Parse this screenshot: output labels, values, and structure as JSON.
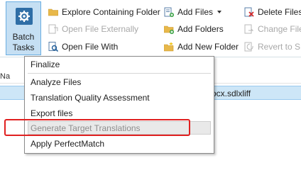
{
  "ribbon": {
    "batch_tasks": {
      "line1": "Batch",
      "line2": "Tasks"
    },
    "col1": [
      {
        "label": "Explore Containing Folder",
        "icon": "folder-icon",
        "disabled": false
      },
      {
        "label": "Open File Externally",
        "icon": "external-file-icon",
        "disabled": true
      },
      {
        "label": "Open File With",
        "icon": "search-file-icon",
        "disabled": false
      }
    ],
    "col2": [
      {
        "label": "Add Files",
        "icon": "add-files-icon",
        "disabled": false
      },
      {
        "label": "Add Folders",
        "icon": "add-folder-icon",
        "disabled": false
      },
      {
        "label": "Add New Folder",
        "icon": "new-folder-icon",
        "disabled": false
      }
    ],
    "col3": [
      {
        "label": "Delete Files",
        "icon": "delete-files-icon",
        "disabled": false
      },
      {
        "label": "Change File",
        "icon": "change-file-icon",
        "disabled": true
      },
      {
        "label": "Revert to SD",
        "icon": "revert-icon",
        "disabled": true
      }
    ]
  },
  "list": {
    "header_fragment": "Na",
    "row_left_fragment": "",
    "row_filename_fragment": "ocx.sdlxliff"
  },
  "menu": {
    "items": [
      {
        "label": "Finalize",
        "disabled": false
      },
      {
        "label": "Analyze Files",
        "disabled": false
      },
      {
        "label": "Translation Quality Assessment",
        "disabled": false
      },
      {
        "label": "Export files",
        "disabled": false
      },
      {
        "label": "Generate Target Translations",
        "disabled": true
      },
      {
        "label": "Apply PerfectMatch",
        "disabled": false
      }
    ]
  },
  "colors": {
    "accent": "#2f6ea6",
    "selected_button": "#c5dff3",
    "highlight_outline": "#e02020"
  }
}
